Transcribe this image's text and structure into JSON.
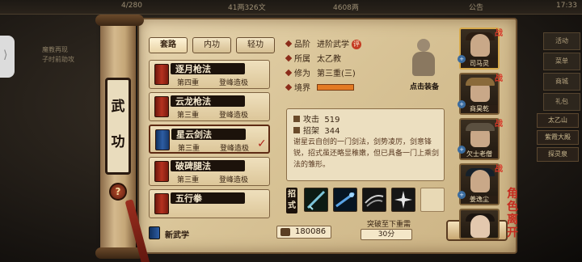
{
  "top_bar": {
    "stamina": "4/280",
    "coins": "41两326文",
    "silver": "4608两",
    "announcement": "公告",
    "time": "17:33"
  },
  "left_notes": {
    "line1": "魔教再现",
    "line2": "子时前助攻"
  },
  "side_tab": {
    "glyph": "⟩"
  },
  "right_menu": [
    "活动",
    "菜单",
    "商城",
    "礼包"
  ],
  "right_list": [
    "太乙山",
    "紫霞大殿",
    "探灵泉"
  ],
  "panel": {
    "title_chars": [
      "武",
      "功"
    ],
    "help_label": "?"
  },
  "tabs": [
    "套路",
    "内功",
    "轻功"
  ],
  "skills": [
    {
      "name": "逐月枪法",
      "level": "第四重",
      "rank": "登峰造极",
      "book_color": "red"
    },
    {
      "name": "云龙枪法",
      "level": "第三重",
      "rank": "登峰造极",
      "book_color": "red"
    },
    {
      "name": "星云剑法",
      "level": "第三重",
      "rank": "登峰造极",
      "book_color": "blue",
      "selected": true,
      "check": "✓"
    },
    {
      "name": "破碑腿法",
      "level": "第三重",
      "rank": "登峰造极",
      "book_color": "red"
    },
    {
      "name": "五行拳",
      "level": "",
      "rank": "",
      "book_color": "red"
    }
  ],
  "new_skill": {
    "label": "新武学",
    "points": "180086"
  },
  "info": {
    "grade_label": "品阶",
    "grade_value": "进阶武学",
    "grade_badge": "评",
    "sect_label": "所属",
    "sect_value": "太乙教",
    "cultivation_label": "修为",
    "cultivation_value": "第三重(三)",
    "realm_label": "境界"
  },
  "portrait": {
    "label": "点击装备"
  },
  "stats": {
    "attack_label": "攻击",
    "attack_value": "519",
    "parry_label": "招架",
    "parry_value": "344"
  },
  "description": "谢星云自创的一门剑法，剑势凌厉，剑意锋锐，招式虽还略显稚嫩，但已具备一门上乘剑法的雏形。",
  "moves": {
    "label": "招式"
  },
  "breakthrough": {
    "requirement_label": "突破至下重需",
    "cost": "30分",
    "button_label": "突 破"
  },
  "roster": [
    {
      "name": "司马灵",
      "active": true
    },
    {
      "name": "商昊乾"
    },
    {
      "name": "欠士老僧"
    },
    {
      "name": "姜逸尘"
    },
    {
      "name": ""
    }
  ],
  "role_tag": [
    "角",
    "色",
    "离",
    "开"
  ],
  "colors": {
    "accent_red": "#b0241b",
    "parchment": "#d8c396",
    "realm_bar": "#e37a23"
  }
}
